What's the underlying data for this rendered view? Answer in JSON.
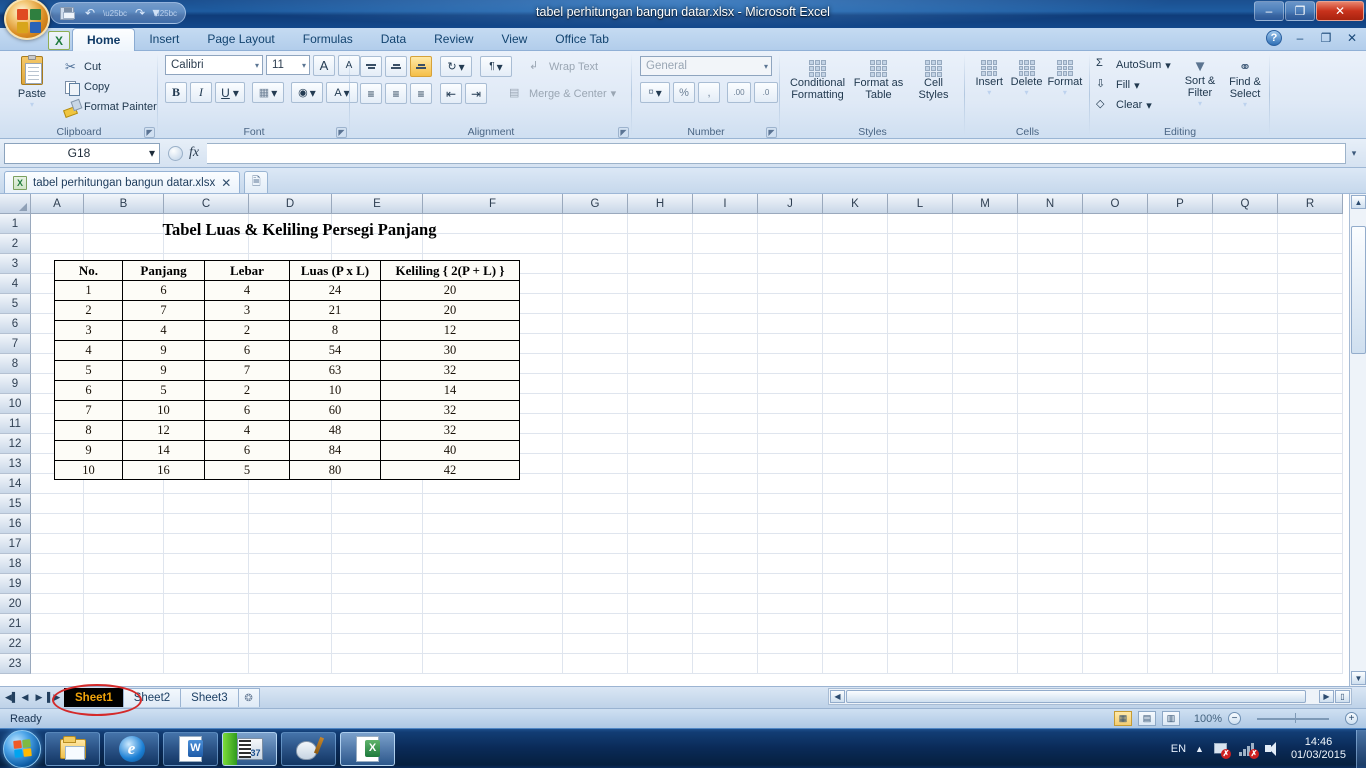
{
  "window": {
    "title": "tabel perhitungan bangun datar.xlsx - Microsoft Excel",
    "minimize": "–",
    "restore": "❐",
    "close": "✕"
  },
  "quick_access": {
    "save": "save-icon",
    "undo": "↶",
    "redo": "↷",
    "customize": "▼"
  },
  "ribbon": {
    "tabs": [
      {
        "label": "Home",
        "active": true
      },
      {
        "label": "Insert",
        "active": false
      },
      {
        "label": "Page Layout",
        "active": false
      },
      {
        "label": "Formulas",
        "active": false
      },
      {
        "label": "Data",
        "active": false
      },
      {
        "label": "Review",
        "active": false
      },
      {
        "label": "View",
        "active": false
      },
      {
        "label": "Office Tab",
        "active": false
      }
    ],
    "help": "?",
    "minimize_ribbon": "–",
    "restore_window": "❐",
    "close_window": "✕",
    "clipboard": {
      "name": "Clipboard",
      "paste": "Paste",
      "cut": "Cut",
      "copy": "Copy",
      "format_painter": "Format Painter"
    },
    "font": {
      "name": "Font",
      "family": "Calibri",
      "size": "11",
      "grow": "A",
      "shrink": "A",
      "bold": "B",
      "italic": "I",
      "underline": "U",
      "borders": "▦",
      "fill_color": "A",
      "font_color": "A"
    },
    "alignment": {
      "name": "Alignment",
      "wrap_text": "Wrap Text",
      "merge_center": "Merge & Center",
      "orientation": "↻",
      "indent_marker": "¶"
    },
    "number": {
      "name": "Number",
      "format": "General",
      "percent": "%",
      "comma": ",",
      "increase_decimal": ".00",
      "decrease_decimal": ".0"
    },
    "styles": {
      "name": "Styles",
      "conditional_formatting": "Conditional Formatting",
      "format_as_table": "Format as Table",
      "cell_styles": "Cell Styles"
    },
    "cells": {
      "name": "Cells",
      "insert": "Insert",
      "delete": "Delete",
      "format": "Format"
    },
    "editing": {
      "name": "Editing",
      "autosum": "AutoSum",
      "fill": "Fill",
      "clear": "Clear",
      "sort_filter": "Sort & Filter",
      "find_select": "Find & Select",
      "sigma": "Σ"
    }
  },
  "formula_bar": {
    "name_box": "G18",
    "fx": "fx",
    "formula": ""
  },
  "office_tab": {
    "document": "tabel perhitungan bangun datar.xlsx",
    "close": "✕",
    "new_tab": "new-document-icon"
  },
  "spreadsheet": {
    "columns": [
      "A",
      "B",
      "C",
      "D",
      "E",
      "F",
      "G",
      "H",
      "I",
      "J",
      "K",
      "L",
      "M",
      "N",
      "O",
      "P",
      "Q",
      "R"
    ],
    "rows": [
      "1",
      "2",
      "3",
      "4",
      "5",
      "6",
      "7",
      "8",
      "9",
      "10",
      "11",
      "12",
      "13",
      "14",
      "15",
      "16",
      "17",
      "18",
      "19",
      "20",
      "21",
      "22",
      "23"
    ],
    "table": {
      "title": "Tabel Luas & Keliling Persegi Panjang",
      "headers": [
        "No.",
        "Panjang",
        "Lebar",
        "Luas (P x L)",
        "Keliling { 2(P + L) }"
      ],
      "rows": [
        [
          "1",
          "6",
          "4",
          "24",
          "20"
        ],
        [
          "2",
          "7",
          "3",
          "21",
          "20"
        ],
        [
          "3",
          "4",
          "2",
          "8",
          "12"
        ],
        [
          "4",
          "9",
          "6",
          "54",
          "30"
        ],
        [
          "5",
          "9",
          "7",
          "63",
          "32"
        ],
        [
          "6",
          "5",
          "2",
          "10",
          "14"
        ],
        [
          "7",
          "10",
          "6",
          "60",
          "32"
        ],
        [
          "8",
          "12",
          "4",
          "48",
          "32"
        ],
        [
          "9",
          "14",
          "6",
          "84",
          "40"
        ],
        [
          "10",
          "16",
          "5",
          "80",
          "42"
        ]
      ]
    }
  },
  "sheet_tabs": {
    "first": "◀▌",
    "prev": "◀",
    "next": "▶",
    "last": "▌▶",
    "tabs": [
      {
        "label": "Sheet1",
        "active": true
      },
      {
        "label": "Sheet2",
        "active": false
      },
      {
        "label": "Sheet3",
        "active": false
      }
    ],
    "insert_sheet": "⊕"
  },
  "status_bar": {
    "text": "Ready",
    "view_normal": "▦",
    "view_page_layout": "▤",
    "view_page_break": "▥",
    "zoom": "100%",
    "zoom_out": "−",
    "zoom_in": "+"
  },
  "taskbar": {
    "start": "start-orb",
    "items": [
      {
        "name": "explorer",
        "icon": "folder-icon"
      },
      {
        "name": "internet-explorer",
        "icon": "ie-icon"
      },
      {
        "name": "word",
        "icon": "word-icon",
        "letter": "W"
      },
      {
        "name": "movie-maker",
        "icon": "movie-maker-icon",
        "letter": "37"
      },
      {
        "name": "paint",
        "icon": "paint-icon"
      },
      {
        "name": "excel",
        "icon": "excel-icon",
        "letter": "X"
      }
    ],
    "tray": {
      "language": "EN",
      "show_hidden": "▲",
      "network": "network-icon",
      "signal": "signal-icon",
      "volume": "volume-icon",
      "time": "14:46",
      "date": "01/03/2015"
    }
  },
  "colors": {
    "accent": "#1e5ca0",
    "active_sheet_bg": "#000000",
    "active_sheet_fg": "#f0a30a",
    "annotation": "#d42a2a"
  }
}
